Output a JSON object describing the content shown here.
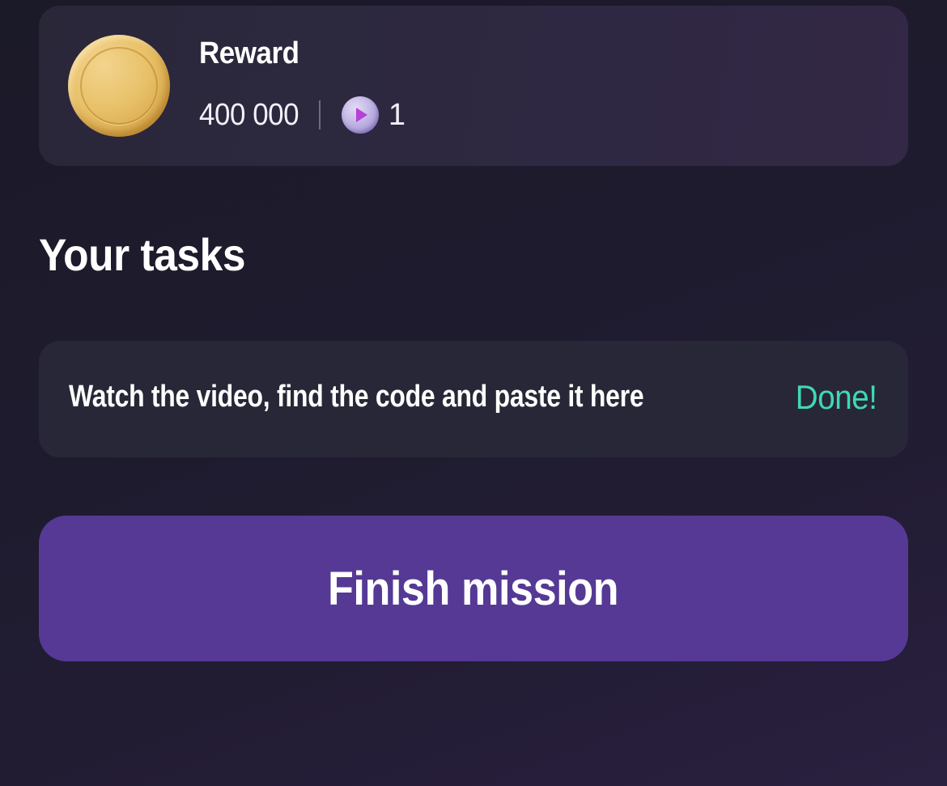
{
  "reward": {
    "title": "Reward",
    "amount": "400 000",
    "coin_icon": "gold-coin-icon",
    "token_icon": "play-token-icon",
    "token_count": "1"
  },
  "tasks": {
    "heading": "Your tasks",
    "items": [
      {
        "text": "Watch the video, find the code and paste it here",
        "status": "Done!"
      }
    ]
  },
  "actions": {
    "finish_label": "Finish mission"
  },
  "colors": {
    "accent_button": "#553995",
    "done_status": "#3fd8b6",
    "card_background": "#282737",
    "coin_gold": "#e8c169",
    "token_purple": "#b9acdf"
  }
}
